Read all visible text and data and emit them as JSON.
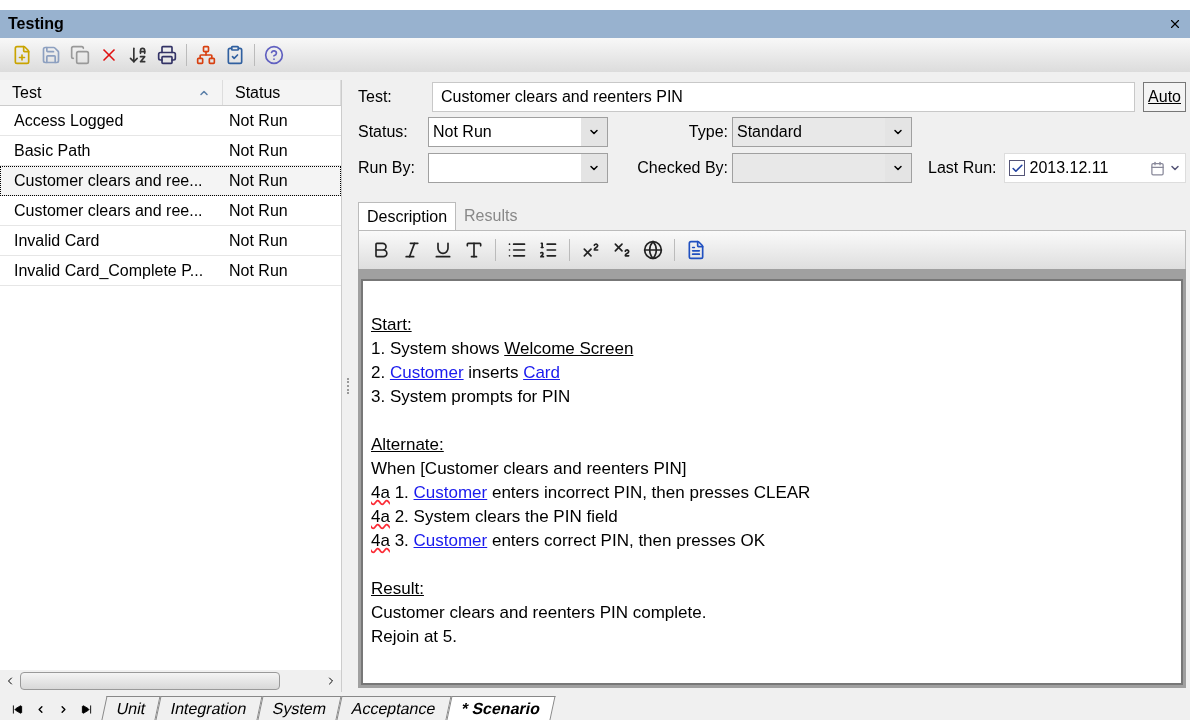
{
  "window": {
    "title": "Testing"
  },
  "test_list": {
    "columns": [
      {
        "label": "Test",
        "sorted": true
      },
      {
        "label": "Status",
        "sorted": false
      }
    ],
    "rows": [
      {
        "test": "Access Logged",
        "status": "Not Run",
        "selected": false
      },
      {
        "test": "Basic Path",
        "status": "Not Run",
        "selected": false
      },
      {
        "test": "Customer clears and ree...",
        "status": "Not Run",
        "selected": true
      },
      {
        "test": "Customer clears and ree...",
        "status": "Not Run",
        "selected": false
      },
      {
        "test": "Invalid Card",
        "status": "Not Run",
        "selected": false
      },
      {
        "test": "Invalid Card_Complete P...",
        "status": "Not Run",
        "selected": false
      }
    ]
  },
  "form": {
    "test": {
      "label": "Test:",
      "value": "Customer clears and reenters PIN"
    },
    "auto_button": "Auto",
    "status": {
      "label": "Status:",
      "value": "Not Run"
    },
    "type": {
      "label": "Type:",
      "value": "Standard"
    },
    "run_by": {
      "label": "Run By:"
    },
    "checked_by": {
      "label": "Checked By:"
    },
    "last_run": {
      "label": "Last Run:",
      "checked": true,
      "value": "2013.12.11"
    }
  },
  "detail_tabs": [
    {
      "label": "Description",
      "selected": true
    },
    {
      "label": "Results",
      "selected": false
    }
  ],
  "description": {
    "blocks": [
      {
        "lines": [
          [
            {
              "kind": "heading",
              "text": "Start:"
            }
          ],
          [
            {
              "kind": "plain",
              "text": "1. System shows "
            },
            {
              "kind": "term",
              "text": "Welcome Screen"
            }
          ],
          [
            {
              "kind": "plain",
              "text": "2. "
            },
            {
              "kind": "link",
              "text": "Customer"
            },
            {
              "kind": "plain",
              "text": " inserts "
            },
            {
              "kind": "link",
              "text": "Card"
            }
          ],
          [
            {
              "kind": "plain",
              "text": "3. System prompts for PIN"
            }
          ]
        ]
      },
      {
        "lines": [
          [
            {
              "kind": "heading",
              "text": "Alternate:"
            }
          ],
          [
            {
              "kind": "plain",
              "text": "When [Customer clears and reenters PIN]"
            }
          ],
          [
            {
              "kind": "misspelled",
              "text": "4a"
            },
            {
              "kind": "plain",
              "text": " 1. "
            },
            {
              "kind": "link",
              "text": "Customer"
            },
            {
              "kind": "plain",
              "text": " enters incorrect PIN, then presses CLEAR"
            }
          ],
          [
            {
              "kind": "misspelled",
              "text": "4a"
            },
            {
              "kind": "plain",
              "text": " 2. System clears the PIN field"
            }
          ],
          [
            {
              "kind": "misspelled",
              "text": "4a"
            },
            {
              "kind": "plain",
              "text": " 3. "
            },
            {
              "kind": "link",
              "text": "Customer"
            },
            {
              "kind": "plain",
              "text": " enters correct PIN, then presses OK"
            }
          ]
        ]
      },
      {
        "lines": [
          [
            {
              "kind": "heading",
              "text": "Result:"
            }
          ],
          [
            {
              "kind": "plain",
              "text": "Customer clears and reenters PIN complete."
            }
          ],
          [
            {
              "kind": "plain",
              "text": "Rejoin at 5."
            }
          ]
        ]
      }
    ]
  },
  "bottom_tabs": [
    {
      "label": "Unit",
      "selected": false
    },
    {
      "label": "Integration",
      "selected": false
    },
    {
      "label": "System",
      "selected": false
    },
    {
      "label": "Acceptance",
      "selected": false
    },
    {
      "label": "* Scenario",
      "selected": true
    }
  ]
}
